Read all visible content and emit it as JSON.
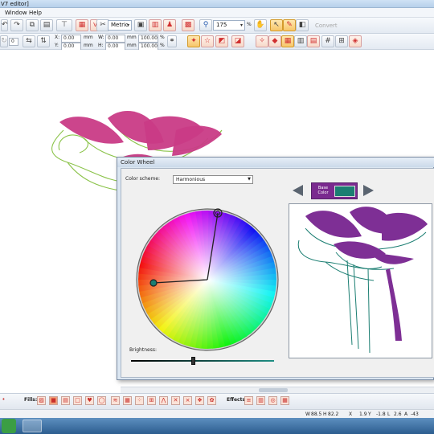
{
  "window": {
    "title": "V7 editor]"
  },
  "menubar": {
    "items": [
      "Window",
      "Help"
    ]
  },
  "toolbar": {
    "units": "Metric",
    "zoom_value": "175",
    "zoom_unit": "%",
    "convert_label": "Convert"
  },
  "position": {
    "x_label": "X:",
    "x_value": "0.00",
    "y_label": "Y:",
    "y_value": "0.00",
    "unit": "mm",
    "w_label": "W:",
    "w_value": "0.00",
    "h_label": "H:",
    "h_value": "0.00",
    "w_pct": "100.00",
    "h_pct": "100.00",
    "pct": "%",
    "rotation": "0"
  },
  "dialog": {
    "title": "Color Wheel",
    "scheme_label": "Color scheme:",
    "scheme_value": "Harmonious",
    "base_color_label": "Base Color",
    "base_color": "#1b7e72",
    "brightness_label": "Brightness:",
    "brightness": 0.43
  },
  "bottombar": {
    "fills_label": "Fills:",
    "effects_label": "Effects:"
  },
  "status": {
    "w_label": "W",
    "w_value": "88.5",
    "h_label": "H",
    "h_value": "82.2",
    "x_label": "X",
    "x_value": "1.9",
    "y_label": "Y",
    "y_value": "-1.8",
    "l_label": "L",
    "l_value": "2.6",
    "a_label": "A",
    "a_value": "-43"
  },
  "colors": {
    "design_fill": "#c93b86",
    "design_outline": "#8bc34a",
    "preview_fill": "#7e2f95",
    "preview_outline": "#1b7e72",
    "accent": "#7a2a8f"
  }
}
